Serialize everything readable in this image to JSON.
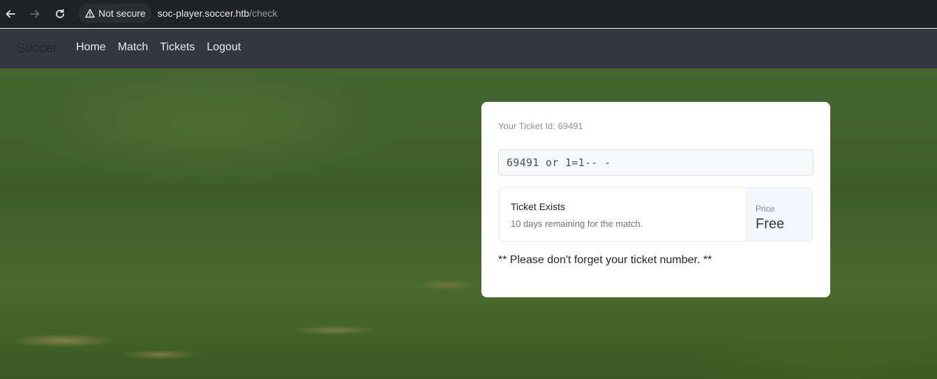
{
  "browser": {
    "security_label": "Not secure",
    "url_host": "soc-player.soccer.htb",
    "url_path": "/check"
  },
  "navbar": {
    "brand": "Soccer",
    "links": [
      "Home",
      "Match",
      "Tickets",
      "Logout"
    ]
  },
  "card": {
    "ticket_id_label": "Your Ticket Id: 69491",
    "input_value": "69491 or 1=1-- -",
    "result": {
      "title": "Ticket Exists",
      "subtitle": "10 days remaining for the match.",
      "price_label": "Price",
      "price_value": "Free"
    },
    "reminder": "** Please don't forget your ticket number. **"
  },
  "colors": {
    "navbar_bg": "#34373d",
    "browser_bg": "#202124"
  },
  "icons": [
    "back-arrow-icon",
    "forward-arrow-icon",
    "reload-icon",
    "warning-triangle-icon"
  ]
}
